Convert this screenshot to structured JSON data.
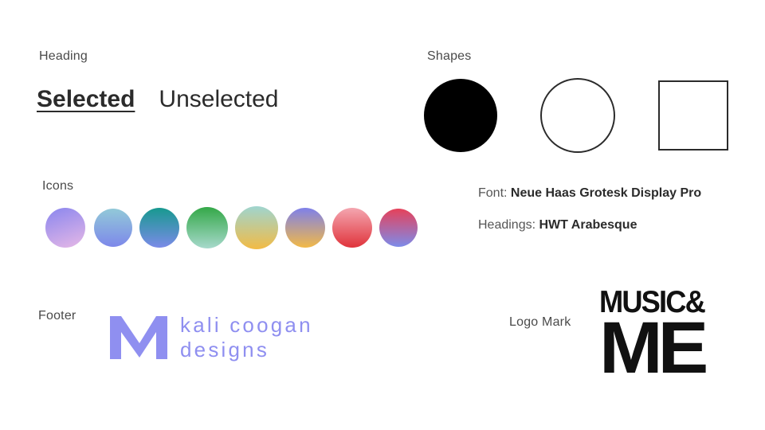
{
  "sections": {
    "heading": "Heading",
    "shapes": "Shapes",
    "icons": "Icons",
    "footer": "Footer",
    "logo_mark": "Logo Mark"
  },
  "heading": {
    "selected": "Selected",
    "unselected": "Unselected"
  },
  "shapes": [
    {
      "name": "filled-circle",
      "color": "#000000"
    },
    {
      "name": "outline-circle",
      "color": "#2b2b2b"
    },
    {
      "name": "outline-square",
      "color": "#2b2b2b"
    }
  ],
  "icons": [
    {
      "name": "purple-pink-gradient",
      "colors": [
        "#8a86ee",
        "#e6b8e6"
      ]
    },
    {
      "name": "teal-blue-gradient",
      "colors": [
        "#92c9d8",
        "#7d88ea"
      ]
    },
    {
      "name": "deep-teal-blue-gradient",
      "colors": [
        "#17998f",
        "#7b8be8"
      ]
    },
    {
      "name": "green-mint-gradient",
      "colors": [
        "#34a848",
        "#a7d9cc"
      ]
    },
    {
      "name": "mint-yellow-gradient",
      "colors": [
        "#9fd5cf",
        "#f2bb45"
      ]
    },
    {
      "name": "blue-yellow-gradient",
      "colors": [
        "#7e80ea",
        "#f2b947"
      ]
    },
    {
      "name": "pink-red-gradient",
      "colors": [
        "#f4a6b0",
        "#e0333b"
      ]
    },
    {
      "name": "red-blue-gradient",
      "colors": [
        "#e6415a",
        "#7d8bea"
      ]
    }
  ],
  "fonts": {
    "font_label": "Font:",
    "font_value": "Neue Haas Grotesk Display Pro",
    "headings_label": "Headings:",
    "headings_value": "HWT Arabesque"
  },
  "footer": {
    "line1": "kali coogan",
    "line2": "designs",
    "color": "#8f8ff0"
  },
  "logo": {
    "line1": "MUSIC&",
    "line2": "ME"
  }
}
